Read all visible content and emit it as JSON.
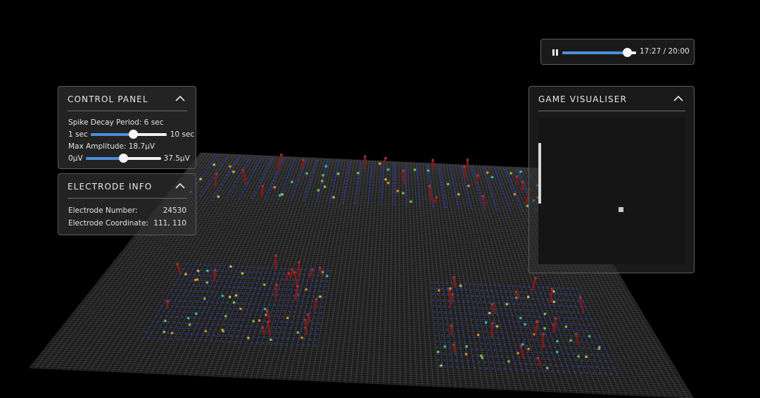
{
  "media_player": {
    "time_display": "17:27 / 20:00",
    "progress_fraction": 0.872,
    "accent_color": "#4a90d9"
  },
  "control_panel": {
    "title": "CONTROL PANEL",
    "spike_decay_label": "Spike Decay Period: 6 sec",
    "spike_decay_min": "1 sec",
    "spike_decay_max": "10 sec",
    "spike_decay_value": 6,
    "spike_decay_range": [
      1,
      10
    ],
    "max_amplitude_label": "Max Amplitude: 18.7µV",
    "max_amplitude_min": "0µV",
    "max_amplitude_max": "37.5µV",
    "max_amplitude_value": 18.7,
    "max_amplitude_range": [
      0,
      37.5
    ]
  },
  "electrode_info": {
    "title": "ELECTRODE INFO",
    "number_label": "Electrode Number:",
    "number_value": "24530",
    "coordinate_label": "Electrode Coordinate:",
    "coordinate_value": "111, 110"
  },
  "game_visualiser": {
    "title": "GAME VISUALISER",
    "background_color": "#151515"
  },
  "scene": {
    "background_color": "#000000",
    "grid_color": "#9a9a9a",
    "active_electrode_color": "#2a3aa8",
    "spike_colors": [
      "#e8d84a",
      "#3ad8c8",
      "#f0a030",
      "#8ce04a"
    ],
    "spike_bar_color": "#7a1c1c"
  }
}
